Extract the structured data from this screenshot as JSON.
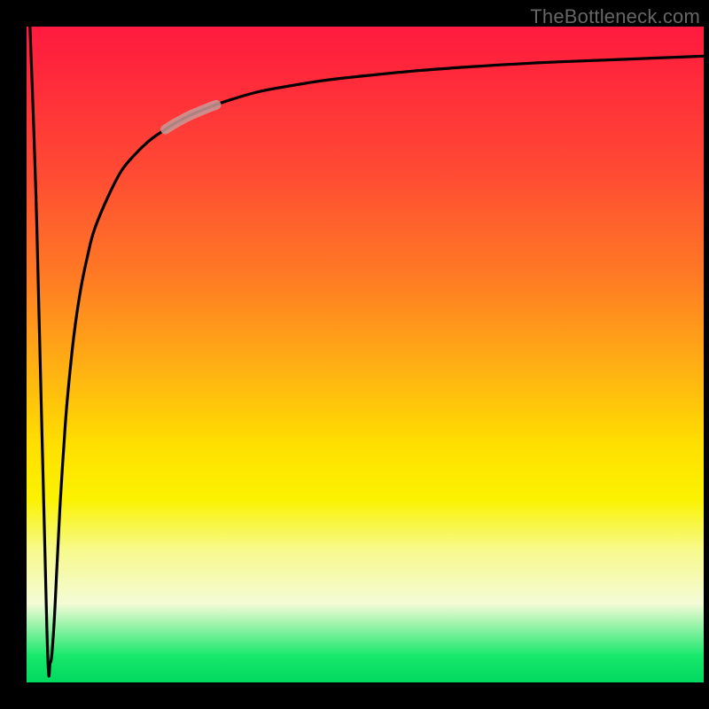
{
  "attribution": "TheBottleneck.com",
  "colors": {
    "gradient_top": "#ff1a3f",
    "gradient_mid1": "#ff7a24",
    "gradient_mid2": "#ffe000",
    "gradient_pale": "#f4fbd6",
    "gradient_bottom": "#00d95f",
    "curve": "#000000",
    "highlight": "#c99a98",
    "background": "#000000"
  },
  "chart_data": {
    "type": "line",
    "title": "",
    "xlabel": "",
    "ylabel": "",
    "xlim": [
      0,
      100
    ],
    "ylim": [
      0,
      100
    ],
    "grid": false,
    "legend": false,
    "annotations": [
      {
        "kind": "segment-highlight",
        "x_range": [
          20.5,
          28
        ],
        "note": "pale thick overlay on curve"
      }
    ],
    "series": [
      {
        "name": "bottleneck-curve",
        "x": [
          0.5,
          1.5,
          3,
          3.5,
          4,
          4.5,
          5,
          5.5,
          6,
          7,
          8,
          9,
          10,
          12,
          14,
          16,
          18,
          20,
          22,
          24,
          27,
          30,
          34,
          38,
          44,
          50,
          58,
          66,
          76,
          88,
          100
        ],
        "y": [
          100,
          70,
          8,
          3,
          8,
          18,
          28,
          36,
          43,
          53,
          60,
          65,
          69,
          74,
          78,
          80.5,
          82.5,
          84,
          85.3,
          86.4,
          87.7,
          88.8,
          90,
          90.8,
          91.8,
          92.5,
          93.3,
          93.9,
          94.5,
          95,
          95.5
        ]
      }
    ]
  }
}
